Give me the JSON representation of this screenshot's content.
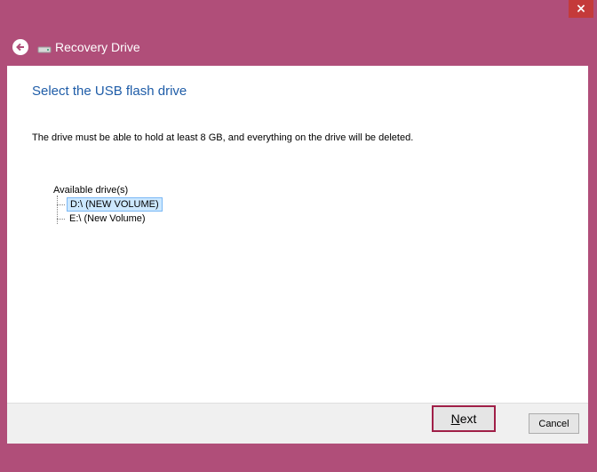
{
  "window": {
    "title": "Recovery Drive",
    "close_glyph": "×",
    "frame_color": "#b04e79"
  },
  "content": {
    "heading": "Select the USB flash drive",
    "description": "The drive must be able to hold at least 8 GB, and everything on the drive will be deleted.",
    "drives_label": "Available drive(s)",
    "drives": [
      {
        "label": "D:\\ (NEW VOLUME)",
        "selected": true
      },
      {
        "label": "E:\\ (New Volume)",
        "selected": false
      }
    ]
  },
  "footer": {
    "next_first": "N",
    "next_rest": "ext",
    "cancel_label": "Cancel"
  },
  "icons": {
    "back": "back-arrow-icon",
    "drive": "drive-icon",
    "close": "close-icon"
  }
}
